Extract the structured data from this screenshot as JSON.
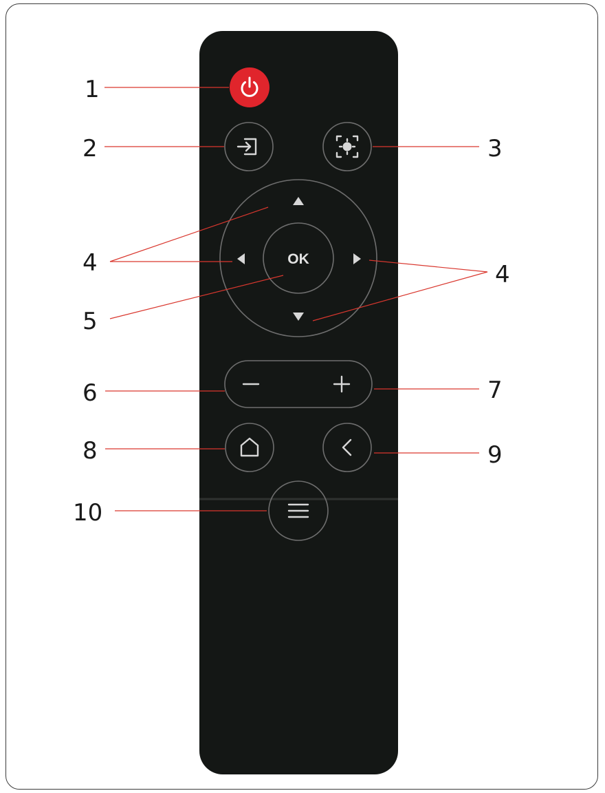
{
  "colors": {
    "remote_body": "#141715",
    "power_button": "#e0252c",
    "leader_line": "#d9372e",
    "button_ring": "#6e6e6e",
    "icon": "#d7d7d7"
  },
  "remote": {
    "buttons": {
      "power": {
        "icon": "power-icon"
      },
      "source": {
        "icon": "input-source-icon"
      },
      "focus": {
        "icon": "focus-icon"
      },
      "dpad": {
        "ok_label": "OK",
        "icons": [
          "arrow-up-icon",
          "arrow-down-icon",
          "arrow-left-icon",
          "arrow-right-icon"
        ]
      },
      "volume": {
        "minus_icon": "minus-icon",
        "plus_icon": "plus-icon"
      },
      "home": {
        "icon": "home-icon"
      },
      "back": {
        "icon": "chevron-left-icon"
      },
      "menu": {
        "icon": "menu-icon"
      }
    }
  },
  "callouts": {
    "c1": "1",
    "c2": "2",
    "c3": "3",
    "c4_left": "4",
    "c4_right": "4",
    "c5": "5",
    "c6": "6",
    "c7": "7",
    "c8": "8",
    "c9": "9",
    "c10": "10"
  }
}
